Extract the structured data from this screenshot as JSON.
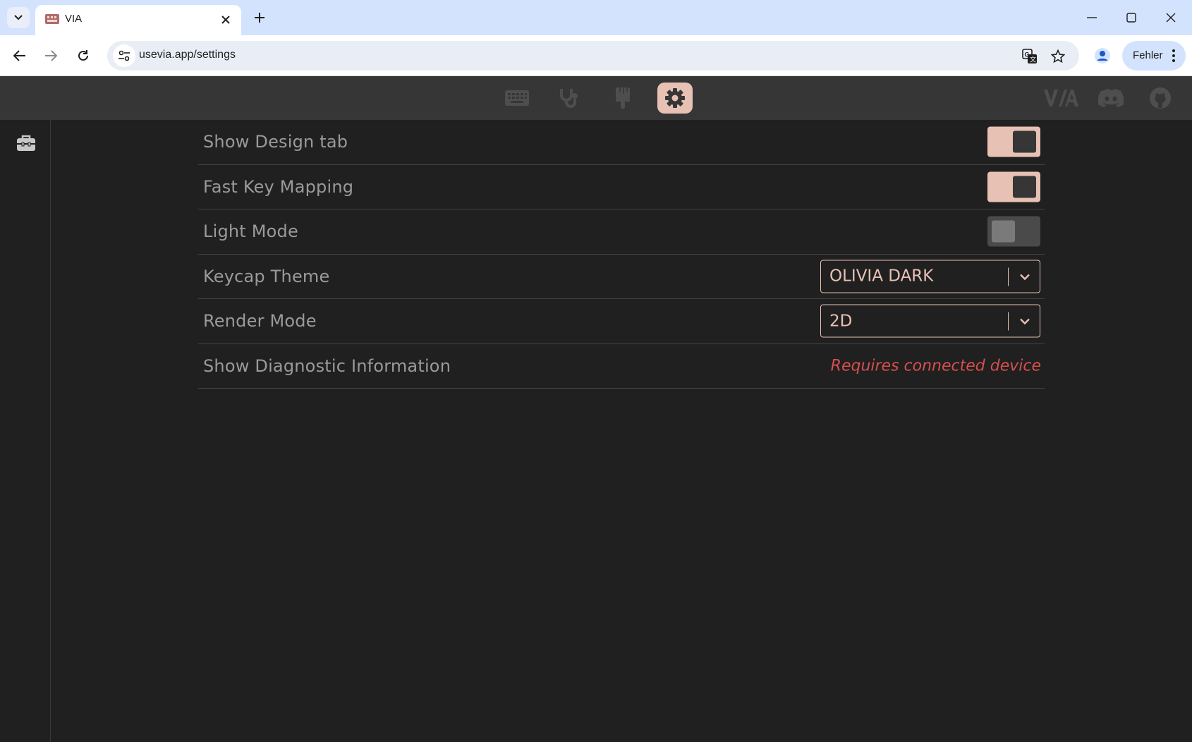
{
  "browser": {
    "tab_title": "VIA",
    "url": "usevia.app/settings",
    "profile_label": "Fehler"
  },
  "app": {
    "top_menu": [
      "keyboard-icon",
      "stethoscope-icon",
      "paintbrush-icon",
      "gear-icon"
    ],
    "active_menu": "gear-icon",
    "brand": "VIA",
    "accent_color": "#e8c1b5",
    "warning_color": "#d94e4e"
  },
  "settings": {
    "show_design_tab": {
      "label": "Show Design tab",
      "enabled": true
    },
    "fast_key_mapping": {
      "label": "Fast Key Mapping",
      "enabled": true
    },
    "light_mode": {
      "label": "Light Mode",
      "enabled": false
    },
    "keycap_theme": {
      "label": "Keycap Theme",
      "value": "OLIVIA DARK"
    },
    "render_mode": {
      "label": "Render Mode",
      "value": "2D"
    },
    "diagnostic": {
      "label": "Show Diagnostic Information",
      "status": "Requires connected device"
    }
  }
}
